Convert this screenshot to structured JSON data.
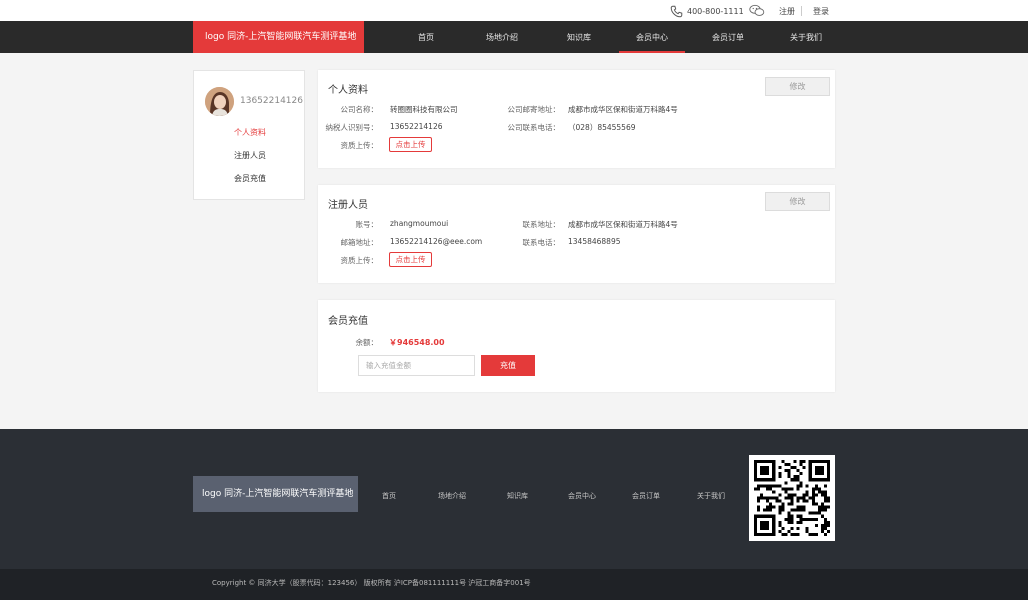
{
  "topbar": {
    "phone": "400-800-1111",
    "register": "注册",
    "login": "登录"
  },
  "nav": {
    "logo": "logo    同济-上汽智能网联汽车测评基地",
    "items": [
      "首页",
      "场地介绍",
      "知识库",
      "会员中心",
      "会员订单",
      "关于我们"
    ],
    "active_index": 3
  },
  "sidebar": {
    "username": "13652214126",
    "links": [
      "个人资料",
      "注册人员",
      "会员充值"
    ],
    "active_index": 0
  },
  "profile": {
    "title": "个人资料",
    "edit_label": "修改",
    "company_name_label": "公司名称：",
    "company_name": "转圈圈科技有限公司",
    "mail_address_label": "公司邮寄地址：",
    "mail_address": "成都市成华区保和街道万科路4号",
    "tax_id_label": "纳税人识别号：",
    "tax_id": "13652214126",
    "company_phone_label": "公司联系电话：",
    "company_phone": "（028）85455569",
    "qualification_label": "资质上传：",
    "upload_label": "点击上传"
  },
  "registrant": {
    "title": "注册人员",
    "edit_label": "修改",
    "account_label": "账号：",
    "account": "zhangmoumoui",
    "address_label": "联系地址：",
    "address": "成都市成华区保和街道万科路4号",
    "email_label": "邮箱地址：",
    "email": "13652214126@eee.com",
    "phone_label": "联系电话：",
    "phone": "13458468895",
    "qualification_label": "资质上传：",
    "upload_label": "点击上传"
  },
  "recharge": {
    "title": "会员充值",
    "balance_label": "余额：",
    "balance": "￥946548.00",
    "input_placeholder": "输入充值金额",
    "button_label": "充值"
  },
  "footer": {
    "logo": "logo    同济-上汽智能网联汽车测评基地",
    "links": [
      "首页",
      "场地介绍",
      "知识库",
      "会员中心",
      "会员订单",
      "关于我们"
    ],
    "copyright": "Copyright  ©  同济大学（股票代码：123456）  版权所有  沪ICP备081111111号  沪冠工商备字001号"
  },
  "colors": {
    "accent": "#e43a3a",
    "nav_bg": "#2a2a2a",
    "footer_bg": "#2b2f35",
    "footer_logo_bg": "#5a6170",
    "page_bg": "#f4f4f4"
  }
}
